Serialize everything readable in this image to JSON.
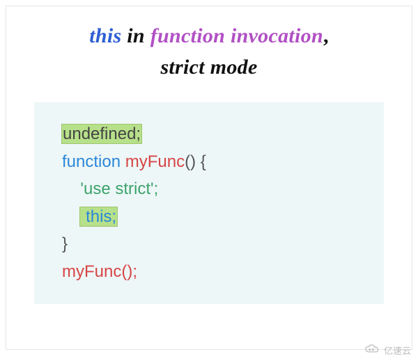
{
  "title": {
    "this": "this",
    "in": "in",
    "func": "function invocation",
    "comma": ",",
    "strict": "strict mode"
  },
  "code": {
    "l1_undefined": "undefined;",
    "l2_function": "function",
    "l2_name": "myFunc",
    "l2_parens": "()",
    "l2_open": "{",
    "l3_str": "'use strict';",
    "l4_this": "this;",
    "l5_close": "}",
    "l6_call": "myFunc();"
  },
  "watermark": "亿速云"
}
